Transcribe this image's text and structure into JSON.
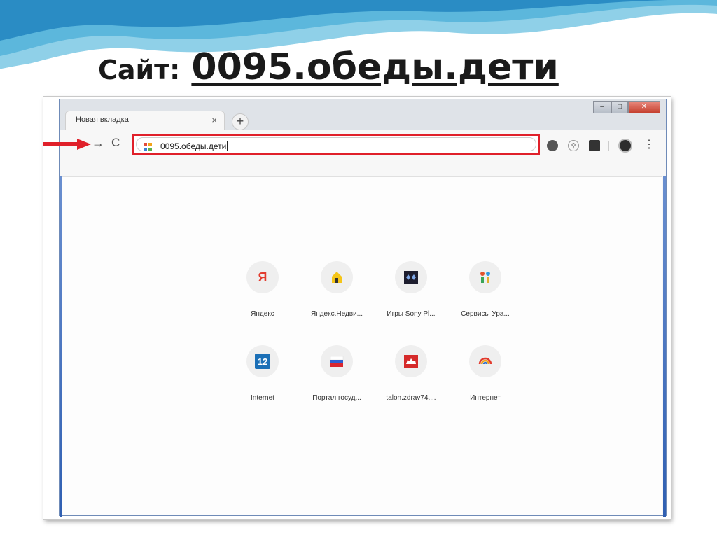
{
  "slide": {
    "title_label": "Сайт:",
    "title_site": "0095.обеды.дети"
  },
  "browser": {
    "tab_title": "Новая вкладка",
    "tab_close": "×",
    "new_tab": "+",
    "omnibox_value": "0095.обеды.дети",
    "nav_back": "→",
    "nav_reload": "C",
    "menu": "⋮",
    "window_controls": {
      "minimize": "–",
      "maximize": "□",
      "close": "✕"
    }
  },
  "shortcuts": [
    {
      "label": "Яндекс",
      "icon": "yandex-icon"
    },
    {
      "label": "Яндекс.Недви...",
      "icon": "yandex-realty-icon"
    },
    {
      "label": "Игры Sony Pl...",
      "icon": "sony-games-icon"
    },
    {
      "label": "Сервисы Ура...",
      "icon": "services-icon"
    },
    {
      "label": "Internet",
      "icon": "internet-12-icon"
    },
    {
      "label": "Портал госуд...",
      "icon": "russia-flag-icon"
    },
    {
      "label": "talon.zdrav74....",
      "icon": "camel-icon"
    },
    {
      "label": "Интернет",
      "icon": "rainbow-icon"
    }
  ],
  "colors": {
    "highlight": "#e0202a",
    "window_border": "#2f5fb2"
  }
}
